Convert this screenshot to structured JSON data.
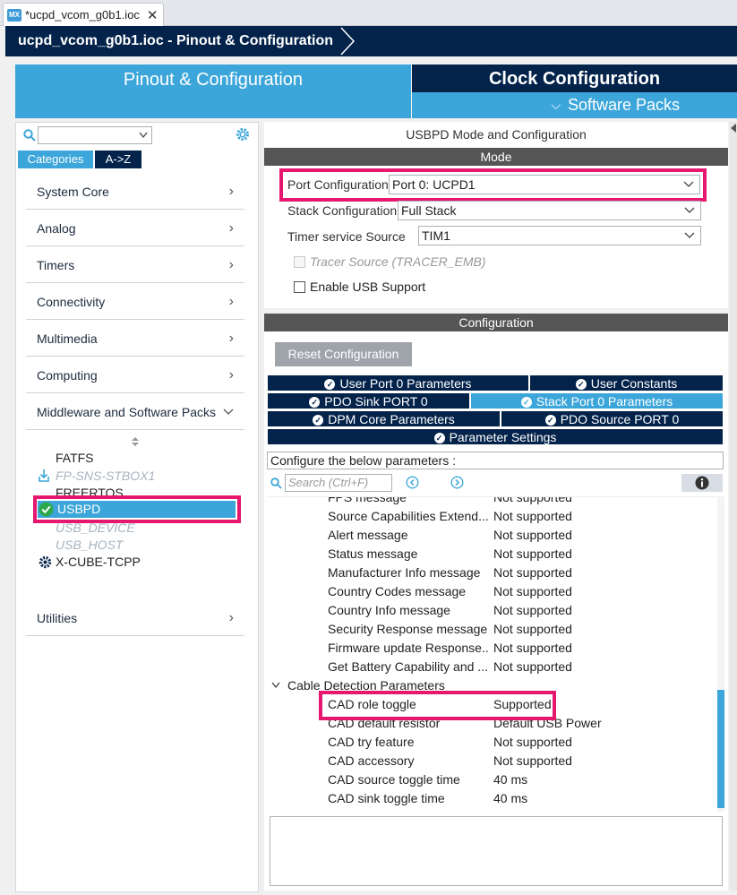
{
  "file_tab": {
    "logo": "MX",
    "title": "*ucpd_vcom_g0b1.ioc",
    "close": "✕"
  },
  "breadcrumb": "ucpd_vcom_g0b1.ioc - Pinout & Configuration",
  "tabs": {
    "pinout": "Pinout & Configuration",
    "clock": "Clock Configuration",
    "software_packs": "Software Packs"
  },
  "left": {
    "tab_categories": "Categories",
    "tab_az": "A->Z",
    "categories": [
      {
        "label": "System Core"
      },
      {
        "label": "Analog"
      },
      {
        "label": "Timers"
      },
      {
        "label": "Connectivity"
      },
      {
        "label": "Multimedia"
      },
      {
        "label": "Computing"
      },
      {
        "label": "Middleware and Software Packs"
      }
    ],
    "middleware_items": [
      {
        "label": "FATFS"
      },
      {
        "label": "FP-SNS-STBOX1"
      },
      {
        "label": "FREERTOS"
      },
      {
        "label": "USBPD"
      },
      {
        "label": "USB_DEVICE"
      },
      {
        "label": "USB_HOST"
      },
      {
        "label": "X-CUBE-TCPP"
      }
    ],
    "utilities": "Utilities"
  },
  "mode": {
    "title": "USBPD Mode and Configuration",
    "section": "Mode",
    "port_config_label": "Port Configuration",
    "port_config_value": "Port 0: UCPD1",
    "stack_config_label": "Stack Configuration",
    "stack_config_value": "Full Stack",
    "timer_label": "Timer service Source",
    "timer_value": "TIM1",
    "tracer_label": "Tracer Source (TRACER_EMB)",
    "enable_usb_label": "Enable USB Support"
  },
  "configuration": {
    "section": "Configuration",
    "reset_button": "Reset Configuration",
    "param_tabs": [
      {
        "label": "User Port 0 Parameters"
      },
      {
        "label": "User Constants"
      },
      {
        "label": "PDO Sink PORT 0"
      },
      {
        "label": "Stack Port 0 Parameters"
      },
      {
        "label": "DPM Core Parameters"
      },
      {
        "label": "PDO Source PORT 0"
      },
      {
        "label": "Parameter Settings"
      }
    ],
    "configure_text": "Configure the below parameters :",
    "search_placeholder": "Search (Ctrl+F)",
    "rows": [
      {
        "name": "FPS message",
        "value": "Not supported"
      },
      {
        "name": "Source Capabilities Extend...",
        "value": "Not supported"
      },
      {
        "name": "Alert message",
        "value": "Not supported"
      },
      {
        "name": "Status message",
        "value": "Not supported"
      },
      {
        "name": "Manufacturer Info message",
        "value": "Not supported"
      },
      {
        "name": "Country Codes message",
        "value": "Not supported"
      },
      {
        "name": "Country Info message",
        "value": "Not supported"
      },
      {
        "name": "Security Response message",
        "value": "Not supported"
      },
      {
        "name": "Firmware update Response...",
        "value": "Not supported"
      },
      {
        "name": "Get Battery Capability and ...",
        "value": "Not supported"
      }
    ],
    "group_label": "Cable Detection Parameters",
    "group_rows": [
      {
        "name": "CAD role toggle",
        "value": "Supported"
      },
      {
        "name": "CAD default resistor",
        "value": "Default USB Power"
      },
      {
        "name": "CAD try feature",
        "value": "Not supported"
      },
      {
        "name": "CAD accessory",
        "value": "Not supported"
      },
      {
        "name": "CAD source toggle time",
        "value": "40 ms"
      },
      {
        "name": "CAD sink toggle time",
        "value": "40 ms"
      }
    ]
  },
  "colors": {
    "navy": "#03234b",
    "blue": "#3ca6da",
    "highlight": "#e5176f",
    "ok_green": "#2aa84a"
  }
}
